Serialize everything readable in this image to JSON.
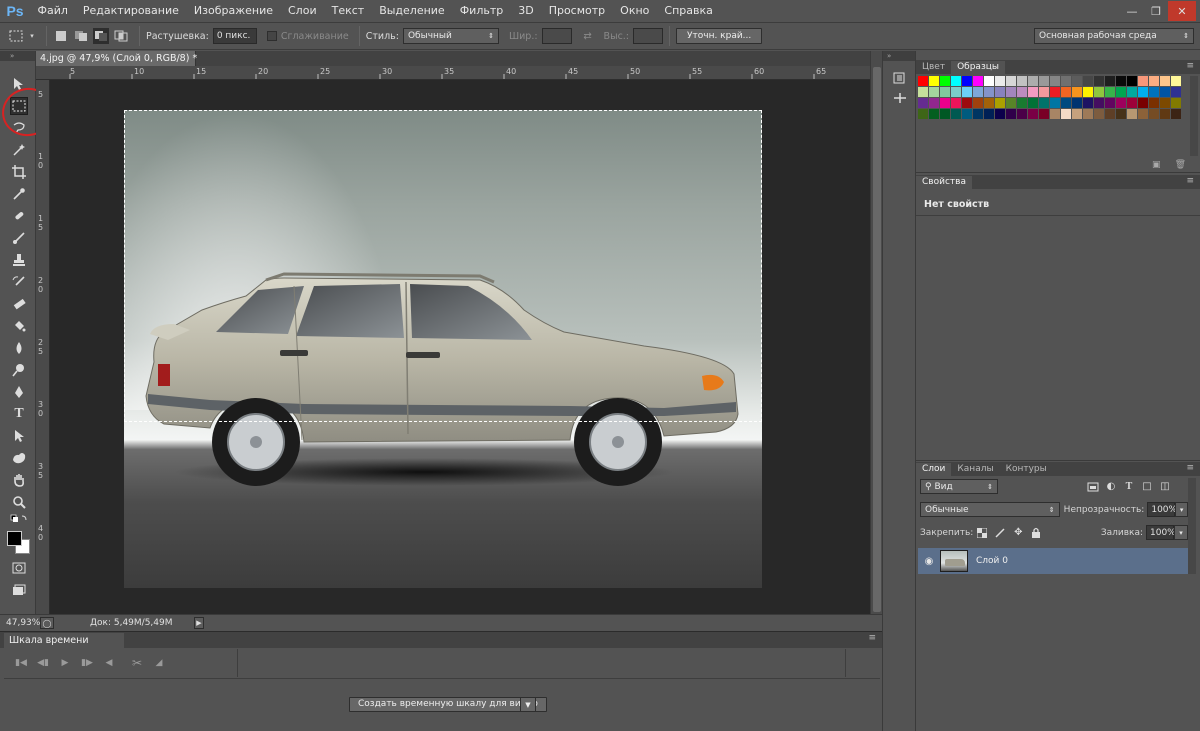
{
  "app": {
    "logo": "Ps"
  },
  "menu": [
    "Файл",
    "Редактирование",
    "Изображение",
    "Слои",
    "Текст",
    "Выделение",
    "Фильтр",
    "3D",
    "Просмотр",
    "Окно",
    "Справка"
  ],
  "options": {
    "feather_label": "Растушевка:",
    "feather_value": "0 пикс.",
    "antialias_label": "Сглаживание",
    "style_label": "Стиль:",
    "style_value": "Обычный",
    "width_label": "Шир.:",
    "height_label": "Выс.:",
    "refine_button": "Уточн. край...",
    "workspace": "Основная рабочая среда"
  },
  "document": {
    "tab_title": "4.jpg @ 47,9% (Слой 0, RGB/8) *",
    "ruler_h": [
      "5",
      "10",
      "15",
      "20",
      "25",
      "30",
      "35",
      "40",
      "45",
      "50",
      "55",
      "60",
      "65"
    ],
    "ruler_v": [
      "5",
      "1 0",
      "1 5",
      "2 0",
      "2 5",
      "3 0",
      "3 5",
      "4 0"
    ],
    "zoom": "47,93%",
    "doc_info": "Док: 5,49M/5,49M"
  },
  "timeline": {
    "title": "Шкала времени",
    "create_button": "Создать временную шкалу для видео"
  },
  "panels": {
    "color_tab": "Цвет",
    "swatches_tab": "Образцы",
    "properties_tab": "Свойства",
    "no_properties": "Нет свойств",
    "layers_tabs": [
      "Слои",
      "Каналы",
      "Контуры"
    ],
    "filter_value": "Вид",
    "blend_mode": "Обычные",
    "opacity_label": "Непрозрачность:",
    "opacity_value": "100%",
    "lock_label": "Закрепить:",
    "fill_label": "Заливка:",
    "fill_value": "100%",
    "layer_name": "Слой 0"
  },
  "colors": {
    "accent_selection": "#5b6f8b",
    "annotation": "#d82222",
    "swatches": [
      "#ff0000",
      "#ffff00",
      "#00ff00",
      "#00ffff",
      "#0000ff",
      "#ff00ff",
      "#ffffff",
      "#ebebeb",
      "#d6d6d6",
      "#c2c2c2",
      "#adadad",
      "#999999",
      "#858585",
      "#707070",
      "#5c5c5c",
      "#474747",
      "#333333",
      "#1f1f1f",
      "#0a0a0a",
      "#000000",
      "#f7977a",
      "#fbad82",
      "#fdc68c",
      "#fff799",
      "#c6df9c",
      "#a4d49d",
      "#81ca9d",
      "#7bcdc8",
      "#6ccff7",
      "#7ea7d8",
      "#8493ca",
      "#8882be",
      "#a286bd",
      "#bc8cbf",
      "#f49bc1",
      "#f5999d",
      "#ee1d24",
      "#f16522",
      "#f7941d",
      "#fff100",
      "#8fc63d",
      "#37b44a",
      "#00a650",
      "#00a99e",
      "#00aeef",
      "#0072bc",
      "#0054a5",
      "#2f3192",
      "#652c91",
      "#91278f",
      "#ec008c",
      "#ed145a",
      "#9d0a0e",
      "#a0410d",
      "#a36209",
      "#aba000",
      "#588528",
      "#197b30",
      "#007236",
      "#00736a",
      "#0076a4",
      "#004a80",
      "#003370",
      "#1d1363",
      "#450e61",
      "#62055f",
      "#9e005d",
      "#9d0039",
      "#790000",
      "#7b3000",
      "#7c4900",
      "#827a00",
      "#3e6617",
      "#045f20",
      "#005824",
      "#005951",
      "#005b7e",
      "#003562",
      "#002056",
      "#0c004b",
      "#30004a",
      "#4b0048",
      "#7a0045",
      "#7a0026",
      "#a88565",
      "#f5dbc7",
      "#c6a17d",
      "#9e7a58",
      "#7d5c3f",
      "#5e3f26",
      "#463219",
      "#b79872",
      "#8c6239",
      "#754c24",
      "#603913",
      "#3c2415"
    ]
  }
}
